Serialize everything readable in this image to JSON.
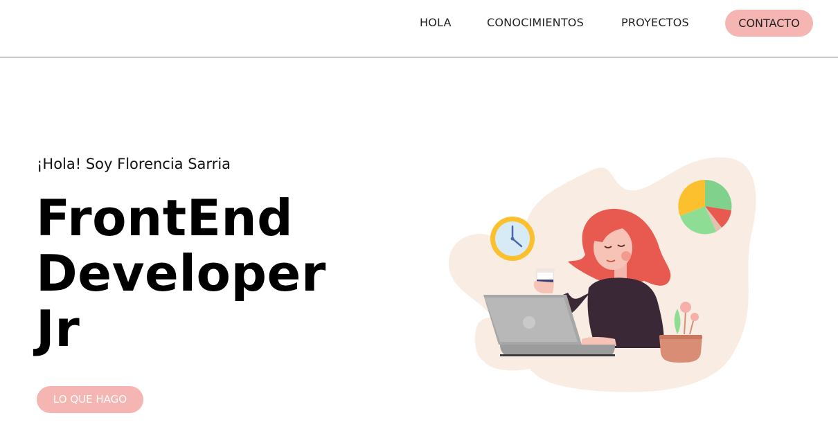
{
  "nav": {
    "items": [
      {
        "label": "HOLA"
      },
      {
        "label": "CONOCIMIENTOS"
      },
      {
        "label": "PROYECTOS"
      }
    ],
    "contact_label": "CONTACTO"
  },
  "hero": {
    "greeting": "¡Hola! Soy Florencia Sarria",
    "title_lines": [
      "FrontEnd",
      "Developer",
      "Jr"
    ],
    "cta_label": "LO QUE HAGO"
  },
  "colors": {
    "accent_pink": "#f5b5b2",
    "blob": "#f9ede3",
    "hair": "#e85a4f",
    "sweater": "#3b2836",
    "laptop": "#a7a7a7",
    "clock": "#fcc02e",
    "pie_green": "#7fd18b",
    "pot": "#d98d75"
  },
  "icons": {
    "illustration": "woman-working-on-laptop-illustration",
    "clock": "clock-icon",
    "pie_chart": "pie-chart-icon"
  }
}
